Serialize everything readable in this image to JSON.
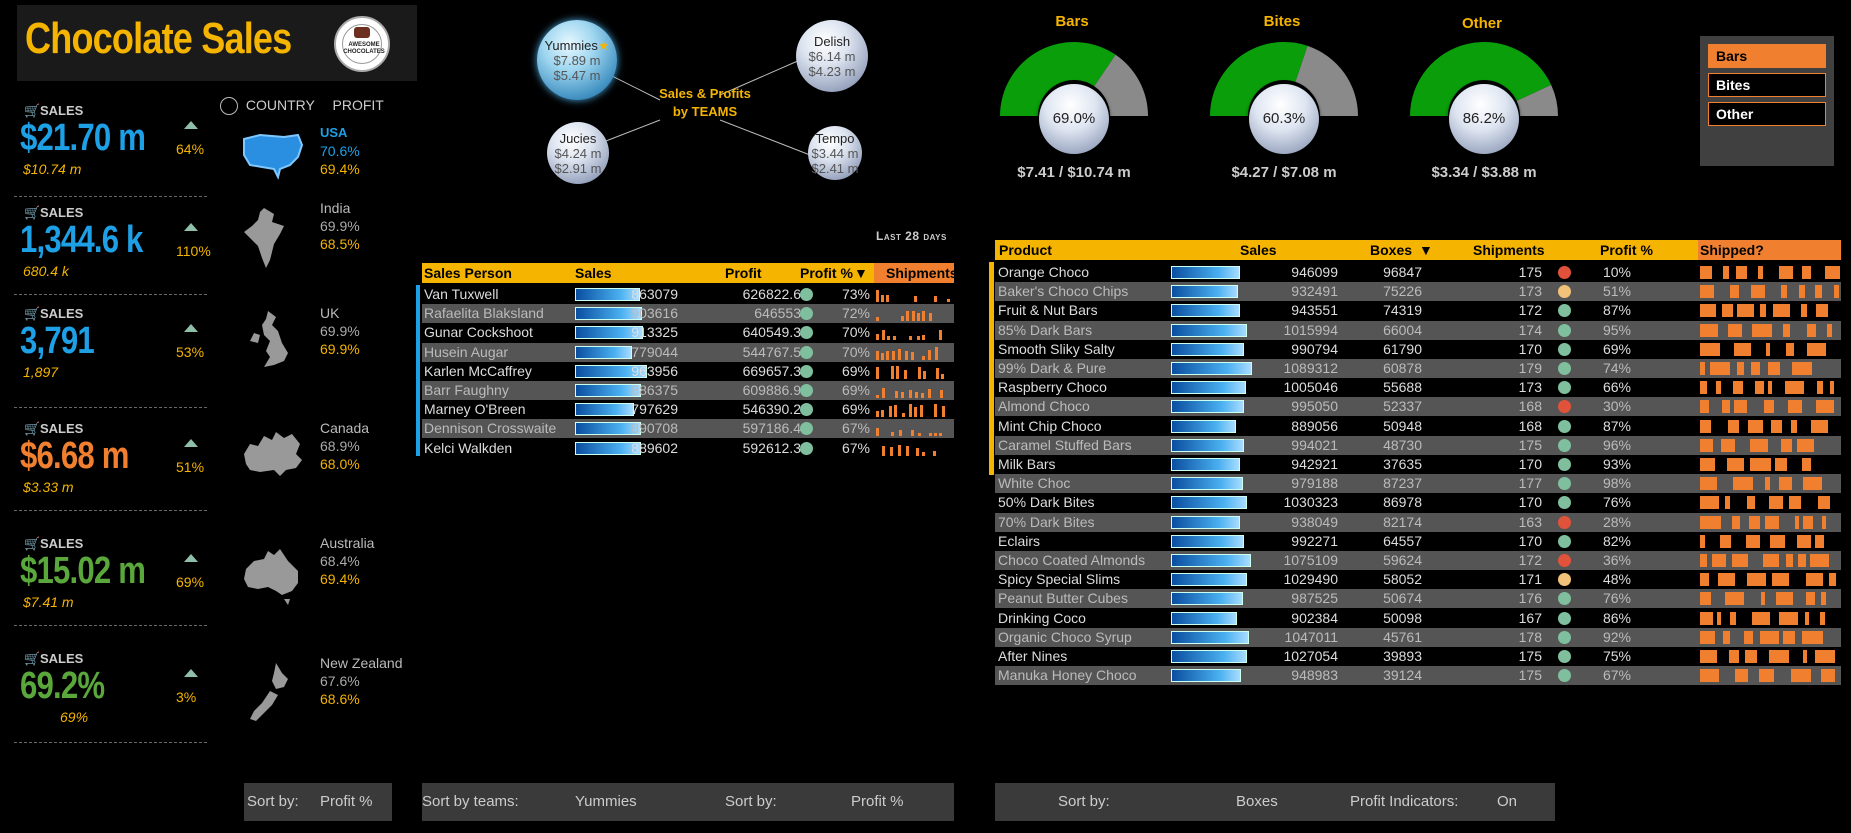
{
  "title": "Chocolate Sales",
  "logo": {
    "text": "AWESOME CHOCOLATES"
  },
  "kpis": [
    {
      "label": "SALES",
      "value": "$21.70 m",
      "sub": "$10.74 m",
      "pct": "64%",
      "color": "#1ea0e6"
    },
    {
      "label": "SALES",
      "value": "1,344.6 k",
      "sub": "680.4 k",
      "pct": "110%",
      "color": "#1ea0e6"
    },
    {
      "label": "SALES",
      "value": "3,791",
      "sub": "1,897",
      "pct": "53%",
      "color": "#1ea0e6"
    },
    {
      "label": "SALES",
      "value": "$6.68 m",
      "sub": "$3.33 m",
      "pct": "51%",
      "color": "#f08030"
    },
    {
      "label": "SALES",
      "value": "$15.02 m",
      "sub": "$7.41 m",
      "pct": "69%",
      "color": "#5aa83c"
    },
    {
      "label": "SALES",
      "value": "69.2%",
      "sub": "69%",
      "pct": "3%",
      "color": "#5aa83c"
    }
  ],
  "country_header": {
    "country": "COUNTRY",
    "profit": "PROFIT"
  },
  "countries": [
    {
      "name": "USA",
      "v1": "70.6%",
      "v2": "69.4%",
      "map": "usa-map-icon"
    },
    {
      "name": "India",
      "v1": "69.9%",
      "v2": "68.5%",
      "map": "india-map-icon"
    },
    {
      "name": "UK",
      "v1": "69.9%",
      "v2": "69.9%",
      "map": "uk-map-icon"
    },
    {
      "name": "Canada",
      "v1": "68.9%",
      "v2": "68.0%",
      "map": "canada-map-icon"
    },
    {
      "name": "Australia",
      "v1": "68.4%",
      "v2": "69.4%",
      "map": "australia-map-icon"
    },
    {
      "name": "New Zealand",
      "v1": "67.6%",
      "v2": "68.6%",
      "map": "new-zealand-map-icon"
    }
  ],
  "sort_country": {
    "label": "Sort by:",
    "value": "Profit %"
  },
  "teams": {
    "center": "Sales & Profits\nby TEAMS",
    "center1": "Sales & Profits",
    "center2": "by TEAMS",
    "items": [
      {
        "name": "Yummies",
        "sales": "$7.89 m",
        "profit": "$5.47 m"
      },
      {
        "name": "Delish",
        "sales": "$6.14 m",
        "profit": "$4.23 m"
      },
      {
        "name": "Jucies",
        "sales": "$4.24 m",
        "profit": "$2.91 m"
      },
      {
        "name": "Tempo",
        "sales": "$3.44 m",
        "profit": "$2.41 m"
      }
    ]
  },
  "last28": "Last 28 days",
  "sp_table": {
    "headers": {
      "person": "Sales Person",
      "sales": "Sales",
      "profit": "Profit",
      "profit_pct": "Profit %",
      "sort_arrow": "▼",
      "shipments": "Shipments"
    },
    "rows": [
      {
        "name": "Van Tuxwell",
        "sales": "863079",
        "profit": "626822.6",
        "pct": "73%",
        "bar": 0.74,
        "dot": "#7fbf9e"
      },
      {
        "name": "Rafaelita Blaksland",
        "sales": "903616",
        "profit": "646553",
        "pct": "72%",
        "bar": 0.76,
        "dot": "#7fbf9e"
      },
      {
        "name": "Gunar Cockshoot",
        "sales": "913325",
        "profit": "640549.3",
        "pct": "70%",
        "bar": 0.77,
        "dot": "#7fbf9e"
      },
      {
        "name": "Husein Augar",
        "sales": "779044",
        "profit": "544767.5",
        "pct": "70%",
        "bar": 0.65,
        "dot": "#7fbf9e"
      },
      {
        "name": "Karlen McCaffrey",
        "sales": "963956",
        "profit": "669657.3",
        "pct": "69%",
        "bar": 0.82,
        "dot": "#7fbf9e"
      },
      {
        "name": "Barr Faughny",
        "sales": "886375",
        "profit": "609886.9",
        "pct": "69%",
        "bar": 0.75,
        "dot": "#7fbf9e"
      },
      {
        "name": "Marney O'Breen",
        "sales": "797629",
        "profit": "546390.2",
        "pct": "69%",
        "bar": 0.67,
        "dot": "#7fbf9e"
      },
      {
        "name": "Dennison Crosswaite",
        "sales": "890708",
        "profit": "597186.4",
        "pct": "67%",
        "bar": 0.75,
        "dot": "#7fbf9e"
      },
      {
        "name": "Kelci Walkden",
        "sales": "889602",
        "profit": "592612.3",
        "pct": "67%",
        "bar": 0.75,
        "dot": "#7fbf9e"
      }
    ]
  },
  "sort_teams": {
    "label": "Sort by teams:",
    "team": "Yummies",
    "label2": "Sort by:",
    "value": "Profit %"
  },
  "gauges": [
    {
      "title": "Bars",
      "pct": "69.0%",
      "value": "$7.41 / $10.74 m",
      "fraction": 0.69
    },
    {
      "title": "Bites",
      "pct": "60.3%",
      "value": "$4.27 / $7.08 m",
      "fraction": 0.603
    },
    {
      "title": "Other",
      "pct": "86.2%",
      "value": "$3.34 / $3.88 m",
      "fraction": 0.862
    }
  ],
  "legend": [
    {
      "label": "Bars",
      "selected": true
    },
    {
      "label": "Bites",
      "selected": false
    },
    {
      "label": "Other",
      "selected": false
    }
  ],
  "product_table": {
    "headers": {
      "product": "Product",
      "sales": "Sales",
      "boxes": "Boxes",
      "sort_arrow": "▼",
      "shipments": "Shipments",
      "profit_pct": "Profit %",
      "shipped": "Shipped?"
    },
    "rows": [
      {
        "name": "Orange Choco",
        "sales": "946099",
        "boxes": "96847",
        "ship": "175",
        "pct": "10%",
        "bar": 0.64,
        "dot": "#e0533a"
      },
      {
        "name": "Baker's Choco Chips",
        "sales": "932491",
        "boxes": "75226",
        "ship": "173",
        "pct": "51%",
        "bar": 0.62,
        "dot": "#f2c27a"
      },
      {
        "name": "Fruit & Nut Bars",
        "sales": "943551",
        "boxes": "74319",
        "ship": "172",
        "pct": "87%",
        "bar": 0.64,
        "dot": "#7fbf9e"
      },
      {
        "name": "85% Dark Bars",
        "sales": "1015994",
        "boxes": "66004",
        "ship": "174",
        "pct": "95%",
        "bar": 0.7,
        "dot": "#7fbf9e"
      },
      {
        "name": "Smooth Sliky Salty",
        "sales": "990794",
        "boxes": "61790",
        "ship": "170",
        "pct": "69%",
        "bar": 0.68,
        "dot": "#7fbf9e"
      },
      {
        "name": "99% Dark & Pure",
        "sales": "1089312",
        "boxes": "60878",
        "ship": "179",
        "pct": "74%",
        "bar": 0.75,
        "dot": "#7fbf9e"
      },
      {
        "name": "Raspberry Choco",
        "sales": "1005046",
        "boxes": "55688",
        "ship": "173",
        "pct": "66%",
        "bar": 0.69,
        "dot": "#7fbf9e"
      },
      {
        "name": "Almond Choco",
        "sales": "995050",
        "boxes": "52337",
        "ship": "168",
        "pct": "30%",
        "bar": 0.68,
        "dot": "#e0533a"
      },
      {
        "name": "Mint Chip Choco",
        "sales": "889056",
        "boxes": "50948",
        "ship": "168",
        "pct": "87%",
        "bar": 0.6,
        "dot": "#7fbf9e"
      },
      {
        "name": "Caramel Stuffed Bars",
        "sales": "994021",
        "boxes": "48730",
        "ship": "175",
        "pct": "96%",
        "bar": 0.68,
        "dot": "#7fbf9e"
      },
      {
        "name": "Milk Bars",
        "sales": "942921",
        "boxes": "37635",
        "ship": "170",
        "pct": "93%",
        "bar": 0.64,
        "dot": "#7fbf9e"
      },
      {
        "name": "White Choc",
        "sales": "979188",
        "boxes": "87237",
        "ship": "177",
        "pct": "98%",
        "bar": 0.67,
        "dot": "#7fbf9e"
      },
      {
        "name": "50% Dark Bites",
        "sales": "1030323",
        "boxes": "86978",
        "ship": "170",
        "pct": "76%",
        "bar": 0.7,
        "dot": "#7fbf9e"
      },
      {
        "name": "70% Dark Bites",
        "sales": "938049",
        "boxes": "82174",
        "ship": "163",
        "pct": "28%",
        "bar": 0.64,
        "dot": "#e0533a"
      },
      {
        "name": "Eclairs",
        "sales": "992271",
        "boxes": "64557",
        "ship": "170",
        "pct": "82%",
        "bar": 0.68,
        "dot": "#7fbf9e"
      },
      {
        "name": "Choco Coated Almonds",
        "sales": "1075109",
        "boxes": "59624",
        "ship": "172",
        "pct": "36%",
        "bar": 0.74,
        "dot": "#e0533a"
      },
      {
        "name": "Spicy Special Slims",
        "sales": "1029490",
        "boxes": "58052",
        "ship": "171",
        "pct": "48%",
        "bar": 0.7,
        "dot": "#f2c27a"
      },
      {
        "name": "Peanut Butter Cubes",
        "sales": "987525",
        "boxes": "50674",
        "ship": "176",
        "pct": "76%",
        "bar": 0.67,
        "dot": "#7fbf9e"
      },
      {
        "name": "Drinking Coco",
        "sales": "902384",
        "boxes": "50098",
        "ship": "167",
        "pct": "86%",
        "bar": 0.61,
        "dot": "#7fbf9e"
      },
      {
        "name": "Organic Choco Syrup",
        "sales": "1047011",
        "boxes": "45761",
        "ship": "178",
        "pct": "92%",
        "bar": 0.72,
        "dot": "#7fbf9e"
      },
      {
        "name": "After Nines",
        "sales": "1027054",
        "boxes": "39893",
        "ship": "175",
        "pct": "75%",
        "bar": 0.7,
        "dot": "#7fbf9e"
      },
      {
        "name": "Manuka Honey Choco",
        "sales": "948983",
        "boxes": "39124",
        "ship": "175",
        "pct": "67%",
        "bar": 0.65,
        "dot": "#7fbf9e"
      }
    ]
  },
  "sort_products": {
    "label": "Sort by:",
    "value": "Boxes",
    "label2": "Profit Indicators:",
    "value2": "On"
  },
  "colors": {
    "accent": "#f5b400",
    "orange": "#f08030",
    "blue": "#1ea0e6",
    "green": "#5aa83c",
    "gauge_green": "#0a9e0a"
  }
}
